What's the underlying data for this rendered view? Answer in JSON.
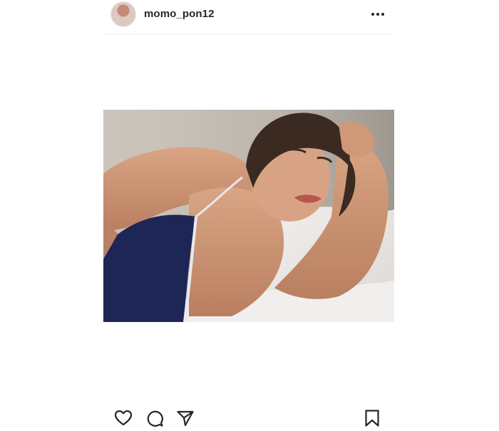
{
  "post": {
    "username": "momo_pon12"
  },
  "icons": {
    "more": "more-options-icon",
    "like": "heart-icon",
    "comment": "comment-icon",
    "share": "paper-plane-icon",
    "save": "bookmark-icon"
  },
  "colors": {
    "text": "#262626",
    "divider": "#efefef"
  }
}
